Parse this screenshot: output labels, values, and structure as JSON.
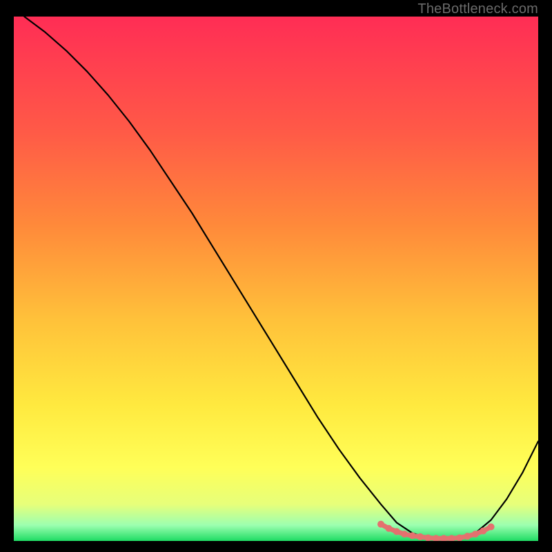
{
  "watermark": "TheBottleneck.com",
  "chart_data": {
    "type": "line",
    "title": "",
    "xlabel": "",
    "ylabel": "",
    "xlim": [
      0,
      100
    ],
    "ylim": [
      0,
      100
    ],
    "grid": false,
    "legend": false,
    "background_gradient": {
      "top": "#ff2d55",
      "mid_upper": "#ff7a3c",
      "mid": "#ffd23a",
      "mid_lower": "#ffff58",
      "near_bottom": "#e7ff7a",
      "bottom": "#1fdc64"
    },
    "series": [
      {
        "name": "curve",
        "color": "#000000",
        "x": [
          2,
          6,
          10,
          14,
          18,
          22,
          26,
          30,
          34,
          38,
          42,
          46,
          50,
          54,
          58,
          62,
          66,
          70,
          73,
          76,
          79,
          82,
          85,
          88,
          91,
          94,
          97,
          100
        ],
        "y": [
          100,
          97,
          93.5,
          89.5,
          85,
          80,
          74.5,
          68.5,
          62.5,
          56,
          49.5,
          43,
          36.5,
          30,
          23.5,
          17.5,
          12,
          7,
          3.5,
          1.5,
          0.5,
          0.3,
          0.5,
          1.5,
          4,
          8,
          13,
          19
        ]
      },
      {
        "name": "optimal-band-markers",
        "color": "#e4716f",
        "style": "points",
        "x": [
          70,
          71.5,
          73,
          74.5,
          76,
          77.5,
          79,
          80.5,
          82,
          83.5,
          85,
          86.5,
          88,
          89.5,
          91
        ],
        "y": [
          3.2,
          2.4,
          1.8,
          1.3,
          1.0,
          0.8,
          0.6,
          0.5,
          0.5,
          0.5,
          0.6,
          0.9,
          1.3,
          1.9,
          2.7
        ]
      }
    ]
  }
}
